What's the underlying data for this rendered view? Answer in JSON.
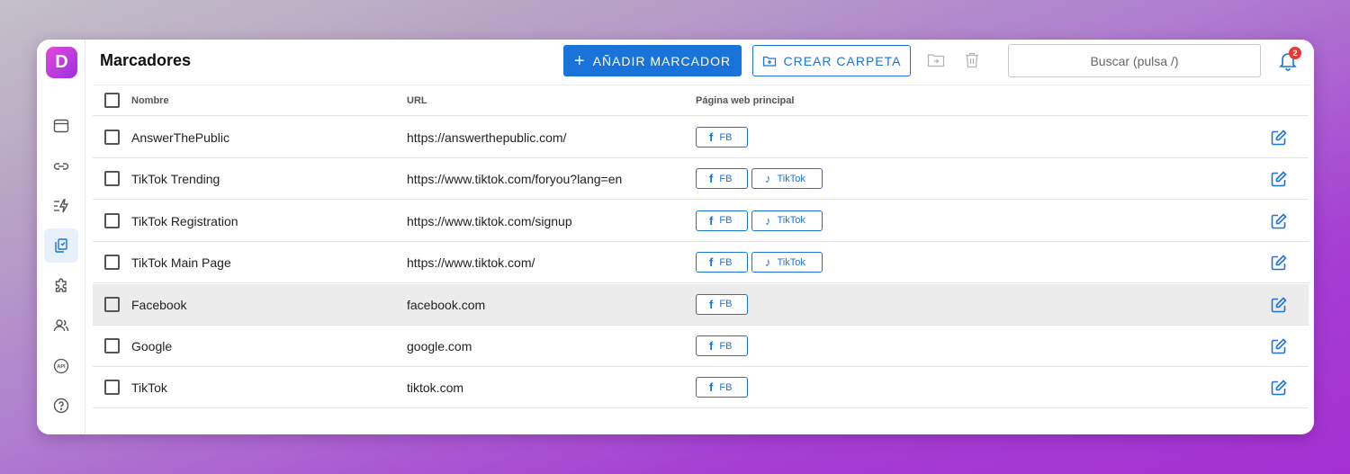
{
  "app": {
    "logo_letter": "D",
    "brand_color": "#9b2fe0",
    "accent_color": "#1a73d9"
  },
  "sidebar": {
    "items": [
      {
        "icon": "browser-window-icon",
        "active": false
      },
      {
        "icon": "link-icon",
        "active": false
      },
      {
        "icon": "automation-icon",
        "active": false
      },
      {
        "icon": "bookmarks-icon",
        "active": true
      },
      {
        "icon": "extension-icon",
        "active": false
      },
      {
        "icon": "users-icon",
        "active": false
      },
      {
        "icon": "api-icon",
        "active": false
      },
      {
        "icon": "help-icon",
        "active": false
      }
    ]
  },
  "header": {
    "title": "Marcadores",
    "add_button": "AÑADIR MARCADOR",
    "create_folder_button": "CREAR CARPETA",
    "search_placeholder": "Buscar (pulsa /)",
    "notifications_count": "2"
  },
  "table": {
    "columns": [
      "Nombre",
      "URL",
      "Página web principal"
    ],
    "rows": [
      {
        "name": "AnswerThePublic",
        "url": "https://answerthepublic.com/",
        "tags": [
          "FB"
        ],
        "highlight": false
      },
      {
        "name": "TikTok Trending",
        "url": "https://www.tiktok.com/foryou?lang=en",
        "tags": [
          "FB",
          "TikTok"
        ],
        "highlight": false
      },
      {
        "name": "TikTok Registration",
        "url": "https://www.tiktok.com/signup",
        "tags": [
          "FB",
          "TikTok"
        ],
        "highlight": false
      },
      {
        "name": "TikTok Main Page",
        "url": "https://www.tiktok.com/",
        "tags": [
          "FB",
          "TikTok"
        ],
        "highlight": false
      },
      {
        "name": "Facebook",
        "url": "facebook.com",
        "tags": [
          "FB"
        ],
        "highlight": true
      },
      {
        "name": "Google",
        "url": "google.com",
        "tags": [
          "FB"
        ],
        "highlight": false
      },
      {
        "name": "TikTok",
        "url": "tiktok.com",
        "tags": [
          "FB"
        ],
        "highlight": false
      }
    ]
  }
}
